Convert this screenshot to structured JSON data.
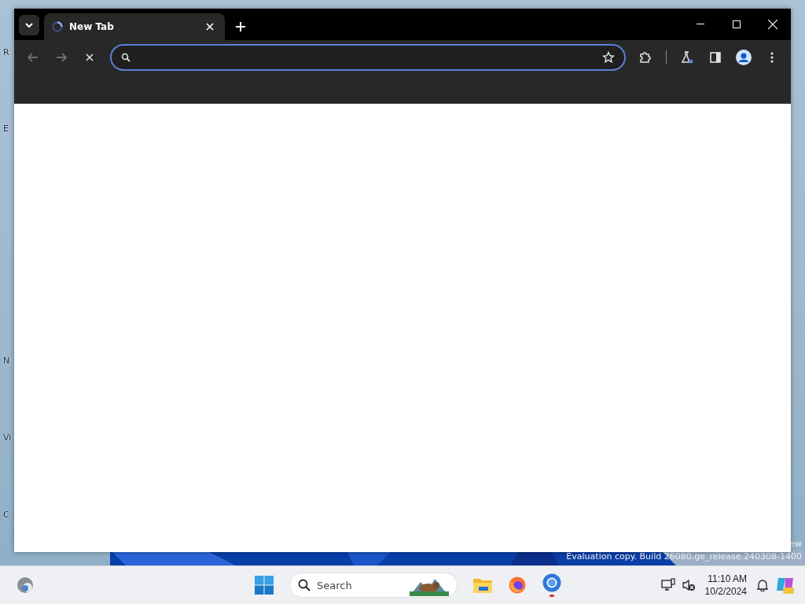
{
  "desktop_icons": [
    {
      "label": "R"
    },
    {
      "label": "E"
    },
    {
      "label": "N"
    },
    {
      "label": "Vi"
    },
    {
      "label": "C"
    }
  ],
  "browser": {
    "tabs": [
      {
        "title": "New Tab",
        "selected": true
      }
    ],
    "toolbar": {
      "back_disabled": true,
      "forward_disabled": true,
      "loading": true
    },
    "omnibox": {
      "focused": true
    }
  },
  "system_watermark": [
    "ew",
    "Evaluation copy. Build 26080.ge_release.240308-1400"
  ],
  "taskbar": {
    "search": {
      "placeholder": "Search"
    },
    "apps": [
      {
        "kind": "files",
        "running": false
      },
      {
        "kind": "firefox",
        "running": false
      },
      {
        "kind": "chrome",
        "running": true
      }
    ],
    "clock": {
      "time": "11:10 AM",
      "date": "10/2/2024"
    }
  }
}
